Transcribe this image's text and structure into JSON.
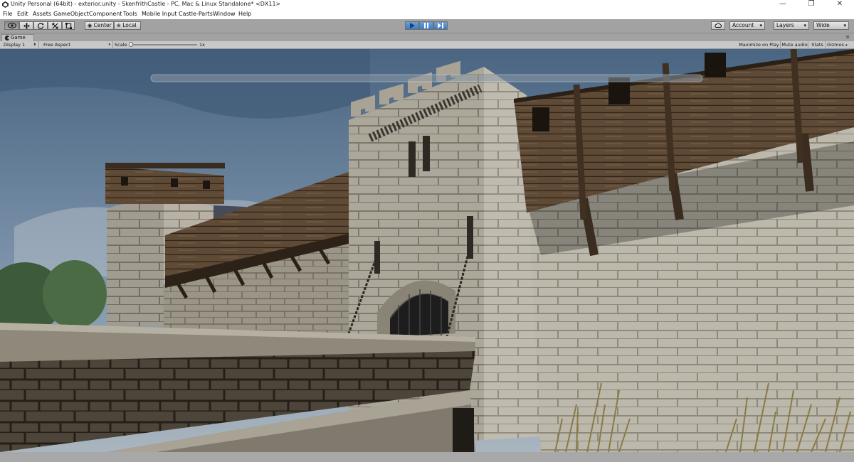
{
  "window": {
    "title": "Unity Personal (64bit) - exterior.unity - SkenfrithCastle - PC, Mac & Linux Standalone* <DX11>",
    "controls": [
      "—",
      "❐",
      "✕"
    ]
  },
  "menu": [
    "File",
    "Edit",
    "Assets",
    "GameObject",
    "Component",
    "Tools",
    "Mobile Input",
    "Castle-Parts",
    "Window",
    "Help"
  ],
  "toolbar": {
    "tools": [
      "hand-tool",
      "move-tool",
      "rotate-tool",
      "scale-tool",
      "rect-tool"
    ],
    "pivot": "Center",
    "space": "Local",
    "account": "Account",
    "layers": "Layers",
    "layout": "Wide"
  },
  "game_view": {
    "tab": "Game",
    "display": "Display 1",
    "aspect": "Free Aspect",
    "scale_label": "Scale",
    "scale_value": "1x",
    "maximize_on_play": "Maximize on Play",
    "mute_audio": "Mute audio",
    "stats": "Stats",
    "gizmos": "Gizmos"
  },
  "colors": {
    "toolbar": "#a2a2a2",
    "play_active": "#4a86cc",
    "sky_top": "#4f6a85",
    "stone": "#b8b3a6"
  }
}
